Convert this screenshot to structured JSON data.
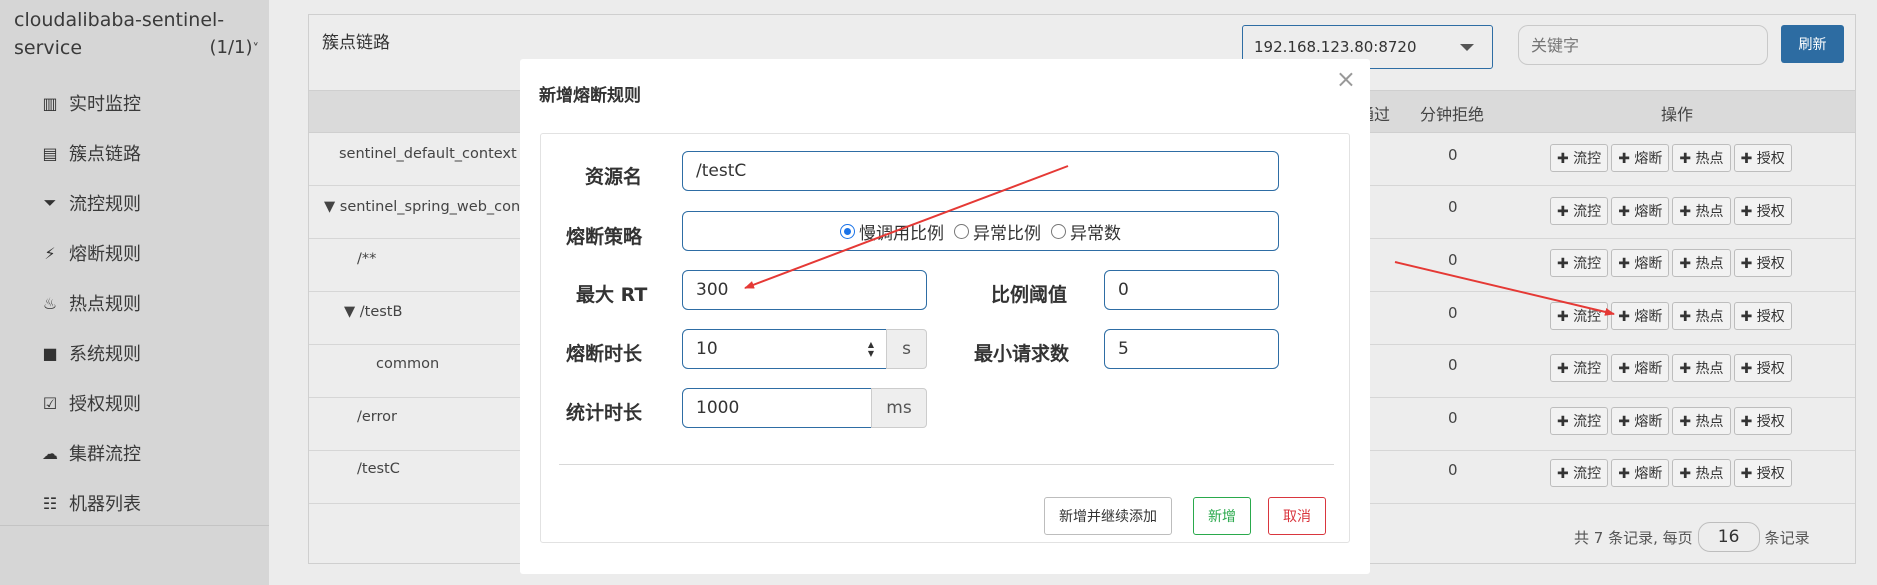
{
  "app": {
    "title_line1": "cloudalibaba-sentinel-",
    "title_line2": "service",
    "count": "(1/1)",
    "chevron": "˅"
  },
  "sidebar": {
    "items": [
      {
        "icon": "bar-chart-icon",
        "glyph": "▥",
        "label": "实时监控"
      },
      {
        "icon": "list-icon",
        "glyph": "▤",
        "label": "簇点链路"
      },
      {
        "icon": "filter-icon",
        "glyph": "⏷",
        "label": "流控规则"
      },
      {
        "icon": "bolt-icon",
        "glyph": "⚡",
        "label": "熔断规则"
      },
      {
        "icon": "fire-icon",
        "glyph": "♨",
        "label": "热点规则"
      },
      {
        "icon": "lock-icon",
        "glyph": "■",
        "label": "系统规则"
      },
      {
        "icon": "check-square-icon",
        "glyph": "☑",
        "label": "授权规则"
      },
      {
        "icon": "cloud-icon",
        "glyph": "☁",
        "label": "集群流控"
      },
      {
        "icon": "th-list-icon",
        "glyph": "☷",
        "label": "机器列表"
      }
    ]
  },
  "main": {
    "panel_title": "簇点链路",
    "machine_select": "192.168.123.80:8720",
    "keyword_placeholder": "关键字",
    "refresh_label": "刷新",
    "headers": {
      "pass": "通过",
      "reject": "分钟拒绝",
      "ops": "操作"
    },
    "rows": [
      {
        "name": "sentinel_default_context",
        "value": "0"
      },
      {
        "name": "▼ sentinel_spring_web_conte",
        "value": "0"
      },
      {
        "name": "/**",
        "value": "0"
      },
      {
        "name": "▼ /testB",
        "value": "0"
      },
      {
        "name": "common",
        "value": "0"
      },
      {
        "name": "/error",
        "value": "0"
      },
      {
        "name": "/testC",
        "value": "0"
      }
    ],
    "op_labels": [
      "✚ 流控",
      "✚ 熔断",
      "✚ 热点",
      "✚ 授权"
    ],
    "pager": {
      "prefix": "共 7 条记录, 每页",
      "page_size": "16",
      "suffix": "条记录"
    }
  },
  "modal": {
    "title": "新增熔断规则",
    "close": "×",
    "resource_label": "资源名",
    "resource_value": "/testC",
    "strategy_label": "熔断策略",
    "strategies": [
      "慢调用比例",
      "异常比例",
      "异常数"
    ],
    "selected_strategy": "慢调用比例",
    "max_rt_label": "最大 RT",
    "max_rt_value": "300",
    "ratio_label": "比例阈值",
    "ratio_value": "0",
    "duration_label": "熔断时长",
    "duration_value": "10",
    "duration_unit": "s",
    "min_req_label": "最小请求数",
    "min_req_value": "5",
    "stat_label": "统计时长",
    "stat_value": "1000",
    "stat_unit": "ms",
    "btn_continue": "新增并继续添加",
    "btn_add": "新增",
    "btn_cancel": "取消"
  },
  "colors": {
    "primary": "#2d6ca2",
    "success": "#2aa94c",
    "danger": "#d9363e",
    "annotation": "#e53935"
  }
}
